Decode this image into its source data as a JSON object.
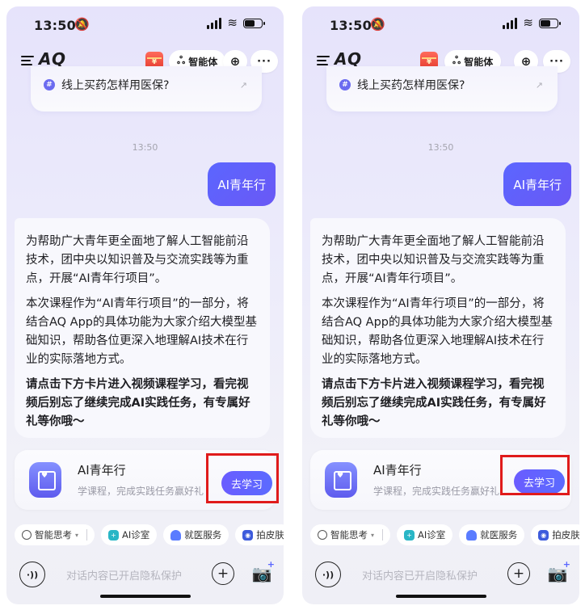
{
  "phones": [
    {
      "status": {
        "time": "13:50",
        "mute_icon": "bell-slash-icon"
      },
      "appbar": {
        "logo": "AQ",
        "gift_label": "¥",
        "agent_label": "智能体",
        "plus_glyph": "⊕",
        "more_glyph": "···"
      },
      "prev_question": "线上买药怎样用医保?",
      "timestamp": "13:50",
      "user_message": "AI青年行",
      "ai_message": {
        "p1": "为帮助广大青年更全面地了解人工智能前沿技术，团中央以知识普及与交流实践等为重点，开展“AI青年行项目”。",
        "p2": "本次课程作为“AI青年行项目”的一部分，将结合AQ App的具体功能为大家介绍大模型基础知识，帮助各位更深入地理解AI技术在行业的实际落地方式。",
        "p3": "请点击下方卡片进入视频课程学习，看完视频后别忘了继续完成AI实践任务，有专属好礼等你哦～"
      },
      "course_card": {
        "title": "AI青年行",
        "subtitle": "学课程，完成实践任务赢好礼",
        "button": "去学习"
      },
      "chips": [
        "智能思考",
        "AI诊室",
        "就医服务",
        "拍皮肤"
      ],
      "chip_caret": "▾",
      "input": {
        "placeholder": "对话内容已开启隐私保护"
      }
    },
    {
      "status": {
        "time": "13:50",
        "mute_icon": "bell-slash-icon"
      },
      "appbar": {
        "logo": "AQ",
        "gift_label": "¥",
        "agent_label": "智能体",
        "plus_glyph": "⊕",
        "more_glyph": "···"
      },
      "prev_question": "线上买药怎样用医保?",
      "timestamp": "13:50",
      "user_message": "AI青年行",
      "ai_message": {
        "p1": "为帮助广大青年更全面地了解人工智能前沿技术，团中央以知识普及与交流实践等为重点，开展“AI青年行项目”。",
        "p2": "本次课程作为“AI青年行项目”的一部分，将结合AQ App的具体功能为大家介绍大模型基础知识，帮助各位更深入地理解AI技术在行业的实际落地方式。",
        "p3": "请点击下方卡片进入视频课程学习，看完视频后别忘了继续完成AI实践任务，有专属好礼等你哦～"
      },
      "course_card": {
        "title": "AI青年行",
        "subtitle": "学课程，完成实践任务赢好礼",
        "button": "去学习"
      },
      "chips": [
        "智能思考",
        "AI诊室",
        "就医服务",
        "拍皮肤"
      ],
      "chip_caret": "▾",
      "input": {
        "placeholder": "对话内容已开启隐私保护"
      }
    }
  ],
  "colors": {
    "accent": "#5b66ff",
    "highlight": "#e01b1b"
  }
}
